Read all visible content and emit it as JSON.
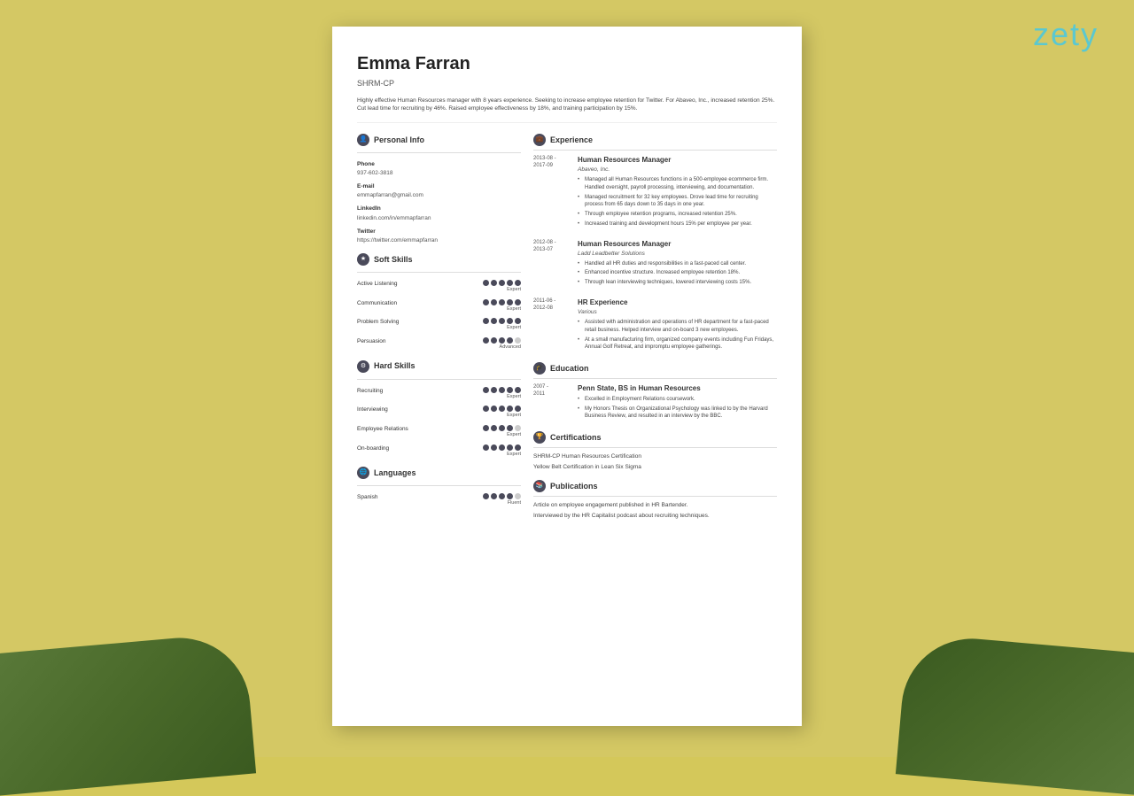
{
  "branding": {
    "logo": "zety"
  },
  "resume": {
    "name": "Emma Farran",
    "credential": "SHRM-CP",
    "summary": "Highly effective Human Resources manager with 8 years experience. Seeking to increase employee retention for Twitter. For Abaveo, Inc., increased retention 25%. Cut lead time for recruiting by 46%. Raised employee effectiveness by 18%, and training participation by 15%.",
    "personal_info": {
      "section_title": "Personal Info",
      "phone_label": "Phone",
      "phone": "937-602-3818",
      "email_label": "E-mail",
      "email": "emmapfarran@gmail.com",
      "linkedin_label": "LinkedIn",
      "linkedin": "linkedin.com/in/emmapfarran",
      "twitter_label": "Twitter",
      "twitter": "https://twitter.com/emmapfarran"
    },
    "soft_skills": {
      "section_title": "Soft Skills",
      "items": [
        {
          "name": "Active Listening",
          "dots": 5,
          "filled": 5,
          "level": "Expert"
        },
        {
          "name": "Communication",
          "dots": 5,
          "filled": 5,
          "level": "Expert"
        },
        {
          "name": "Problem Solving",
          "dots": 5,
          "filled": 5,
          "level": "Expert"
        },
        {
          "name": "Persuasion",
          "dots": 5,
          "filled": 4,
          "level": "Advanced"
        }
      ]
    },
    "hard_skills": {
      "section_title": "Hard Skills",
      "items": [
        {
          "name": "Recruiting",
          "dots": 5,
          "filled": 5,
          "level": "Expert"
        },
        {
          "name": "Interviewing",
          "dots": 5,
          "filled": 5,
          "level": "Expert"
        },
        {
          "name": "Employee Relations",
          "dots": 5,
          "filled": 4,
          "level": "Expert"
        },
        {
          "name": "On-boarding",
          "dots": 5,
          "filled": 5,
          "level": "Expert"
        }
      ]
    },
    "languages": {
      "section_title": "Languages",
      "items": [
        {
          "name": "Spanish",
          "dots": 5,
          "filled": 4,
          "level": "Fluent"
        }
      ]
    },
    "experience": {
      "section_title": "Experience",
      "items": [
        {
          "date_start": "2013-08 -",
          "date_end": "2017-09",
          "job_title": "Human Resources Manager",
          "company": "Abaveo, Inc.",
          "bullets": [
            "Managed all Human Resources functions in a 500-employee ecommerce firm. Handled oversight, payroll processing, interviewing, and documentation.",
            "Managed recruitment for 32 key employees. Drove lead time for recruiting process from 65 days down to 35 days in one year.",
            "Through employee retention programs, increased retention 25%.",
            "Increased training and development hours 15% per employee per year."
          ]
        },
        {
          "date_start": "2012-08 -",
          "date_end": "2013-07",
          "job_title": "Human Resources Manager",
          "company": "Ladd Leadbetter Solutions",
          "bullets": [
            "Handled all HR duties and responsibilities in a fast-paced call center.",
            "Enhanced incentive structure. Increased employee retention 18%.",
            "Through lean interviewing techniques, lowered interviewing costs 15%."
          ]
        },
        {
          "date_start": "2011-06 -",
          "date_end": "2012-08",
          "job_title": "HR Experience",
          "company": "Various",
          "bullets": [
            "Assisted with administration and operations of HR department for a fast-paced retail business. Helped interview and on-board 3 new employees.",
            "At a small manufacturing firm, organized company events including Fun Fridays, Annual Golf Retreat, and impromptu employee gatherings."
          ]
        }
      ]
    },
    "education": {
      "section_title": "Education",
      "items": [
        {
          "date_start": "2007 -",
          "date_end": "2011",
          "degree": "Penn State, BS in Human Resources",
          "bullets": [
            "Excelled in Employment Relations coursework.",
            "My Honors Thesis on Organizational Psychology was linked to by the Harvard Business Review, and resulted in an interview by the BBC."
          ]
        }
      ]
    },
    "certifications": {
      "section_title": "Certifications",
      "items": [
        "SHRM-CP Human Resources Certification",
        "Yellow Belt Certification in Lean Six Sigma"
      ]
    },
    "publications": {
      "section_title": "Publications",
      "items": [
        "Article on employee engagement published in HR Bartender.",
        "Interviewed by the HR Capitalist podcast about recruiting techniques."
      ]
    }
  }
}
